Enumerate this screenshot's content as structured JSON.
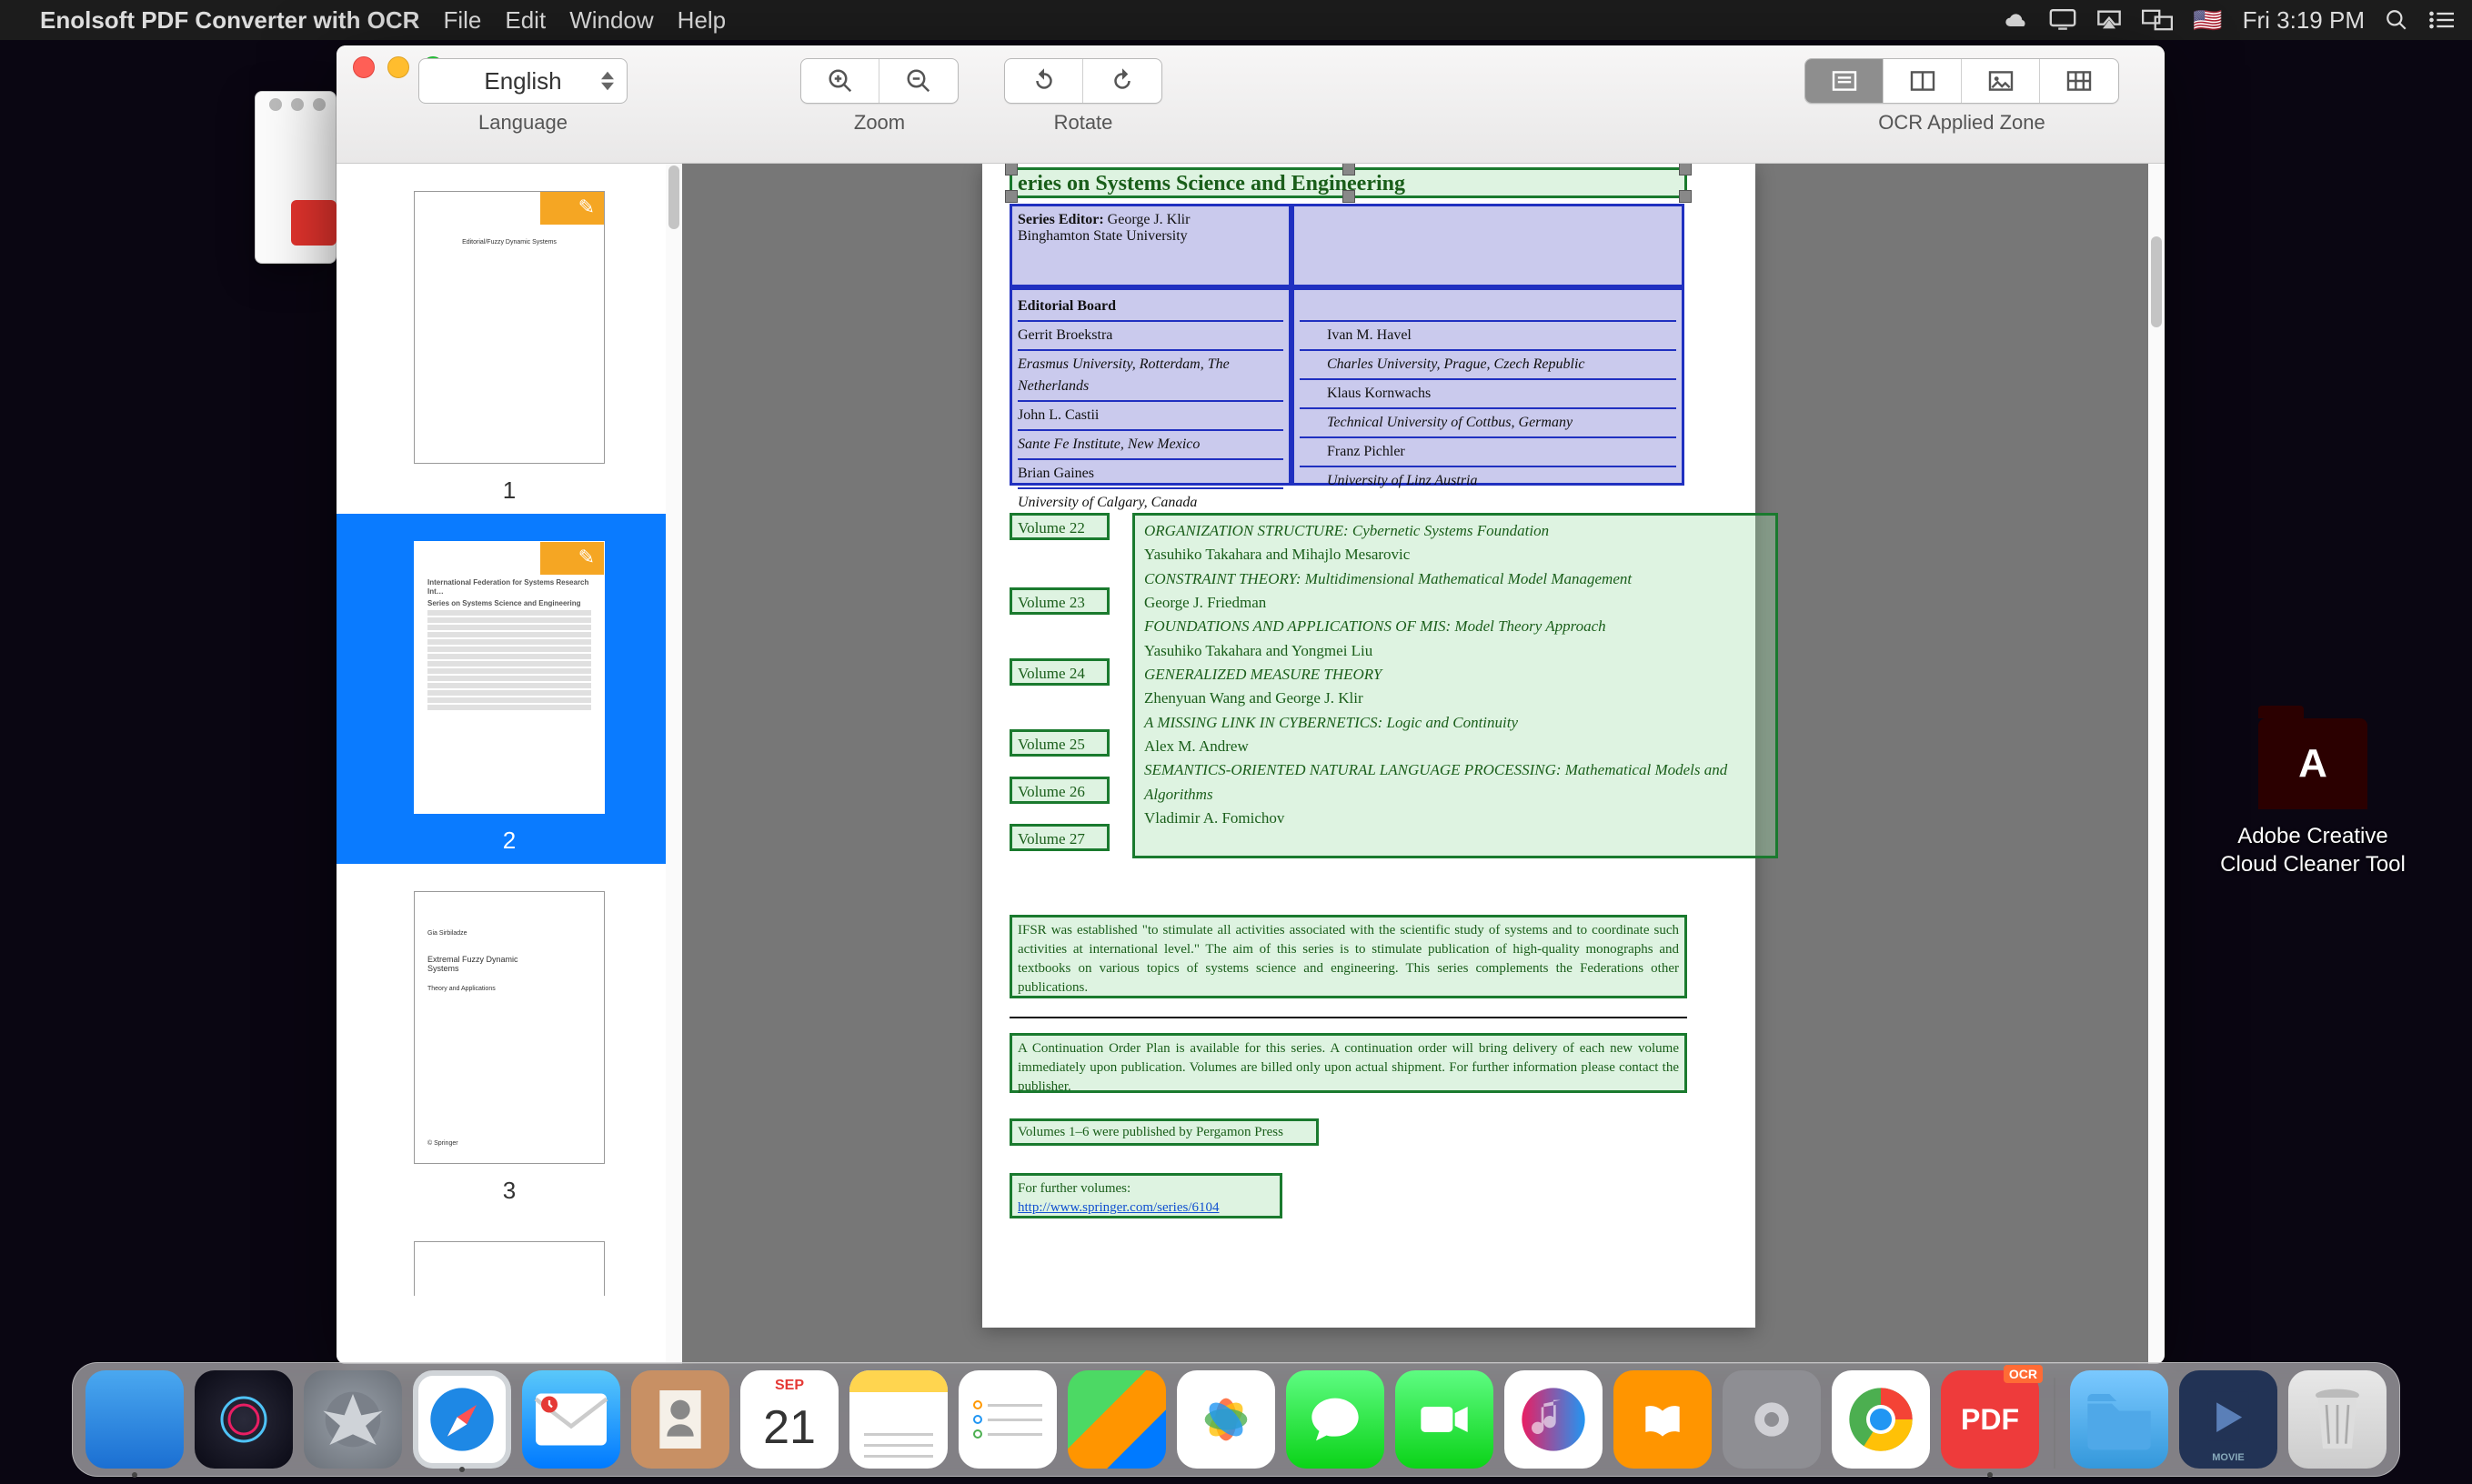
{
  "menubar": {
    "app_name": "Enolsoft PDF Converter with OCR",
    "items": [
      "File",
      "Edit",
      "Window",
      "Help"
    ],
    "clock": "Fri 3:19 PM"
  },
  "desktop": {
    "icon1_label": "Adobe Creative Cloud Cleaner Tool"
  },
  "window": {
    "language": {
      "label": "Language",
      "value": "English"
    },
    "zoom_label": "Zoom",
    "rotate_label": "Rotate",
    "ocr_zone_label": "OCR Applied Zone"
  },
  "thumbnails": {
    "p1": {
      "num": "1",
      "title": "Editorial/Fuzzy Dynamic Systems"
    },
    "p2": {
      "num": "2"
    },
    "p3": {
      "num": "3",
      "l1": "Gia Sirbiladze",
      "l2": "Extremal Fuzzy Dynamic Systems",
      "l3": "Theory and Applications",
      "pub": "© Springer"
    }
  },
  "page": {
    "title": "eries on Systems Science and Engineering",
    "series_editor_label": "Series Editor:",
    "series_editor": "George J. Klir",
    "series_editor_aff": "Binghamton State University",
    "editorial_board_label": "Editorial Board",
    "board_left": [
      "Gerrit Broekstra",
      "Erasmus University, Rotterdam, The Netherlands",
      "John L. Castii",
      "Sante Fe Institute, New Mexico",
      "",
      "Brian Gaines",
      "University of Calgary, Canada"
    ],
    "board_right": [
      "Ivan M. Havel",
      "Charles University, Prague, Czech Republic",
      "Klaus Kornwachs",
      "Technical University of Cottbus, Germany",
      "Franz Pichler",
      "University of Linz Austria"
    ],
    "volumes": [
      {
        "n": "Volume 22",
        "t": "ORGANIZATION STRUCTURE: Cybernetic Systems Foundation",
        "a": "Yasuhiko Takahara and Mihajlo Mesarovic"
      },
      {
        "n": "Volume 23",
        "t": "CONSTRAINT THEORY: Multidimensional Mathematical Model Management",
        "a": "George J. Friedman"
      },
      {
        "n": "Volume 24",
        "t": "FOUNDATIONS AND APPLICATIONS OF MIS: Model Theory Approach",
        "a": "Yasuhiko Takahara and Yongmei Liu"
      },
      {
        "n": "Volume 25",
        "t": "GENERALIZED MEASURE THEORY",
        "a": "Zhenyuan Wang and George J. Klir"
      },
      {
        "n": "Volume 26",
        "t": "A MISSING LINK IN CYBERNETICS: Logic and Continuity",
        "a": "Alex M. Andrew"
      },
      {
        "n": "Volume 27",
        "t": "SEMANTICS-ORIENTED NATURAL LANGUAGE PROCESSING: Mathematical Models and Algorithms",
        "a": "Vladimir A. Fomichov"
      }
    ],
    "para1": "IFSR was established \"to stimulate all activities associated with the scientific study of systems and to coordinate such activities at international level.\" The aim of this series is to stimulate publication of high-quality monographs and textbooks on various topics of systems science and engineering. This series complements the Federations other publications.",
    "para2": "A Continuation Order Plan is available for this series. A continuation order will bring delivery of each new volume immediately upon publication. Volumes are billed only upon actual shipment. For further information please contact the publisher.",
    "para3": "Volumes 1–6 were published by Pergamon Press",
    "para4a": "For further volumes:",
    "para4b": "http://www.springer.com/series/6104"
  },
  "dock": {
    "cal_month": "SEP",
    "cal_day": "21",
    "pdf_label": "PDF",
    "ocr_badge": "OCR",
    "movie_label": "MOVIE"
  }
}
